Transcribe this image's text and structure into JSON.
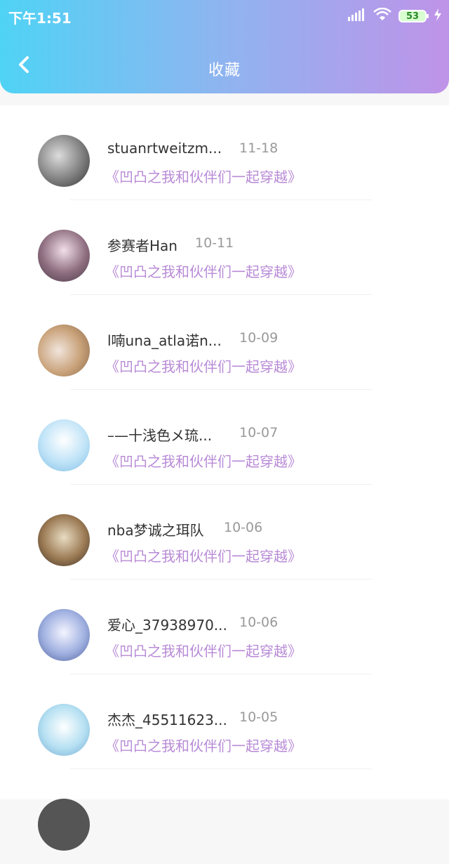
{
  "status_bar": {
    "time": "下午1:51",
    "battery": "53"
  },
  "nav": {
    "title": "收藏"
  },
  "items": [
    {
      "name": "stuanrtweitzm...",
      "date": "11-18",
      "work": "《凹凸之我和伙伴们一起穿越》"
    },
    {
      "name": "参赛者Han",
      "date": "10-11",
      "work": "《凹凸之我和伙伴们一起穿越》"
    },
    {
      "name": "l喃una_atla诺n...",
      "date": "10-09",
      "work": "《凹凸之我和伙伴们一起穿越》"
    },
    {
      "name": "–—十浅色メ琉...",
      "date": "10-07",
      "work": "《凹凸之我和伙伴们一起穿越》"
    },
    {
      "name": "nba梦诚之珥队",
      "date": "10-06",
      "work": "《凹凸之我和伙伴们一起穿越》"
    },
    {
      "name": "爱心_37938970...",
      "date": "10-06",
      "work": "《凹凸之我和伙伴们一起穿越》"
    },
    {
      "name": "杰杰_45511623...",
      "date": "10-05",
      "work": "《凹凸之我和伙伴们一起穿越》"
    }
  ]
}
